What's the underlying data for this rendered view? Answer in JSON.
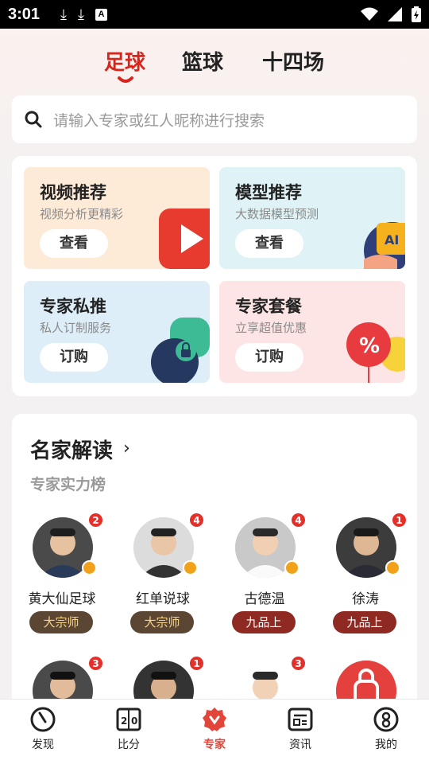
{
  "status_bar": {
    "time": "3:01",
    "icons": [
      "download-icon",
      "download-icon",
      "a-icon",
      "wifi-icon",
      "signal-icon",
      "battery-charging-icon"
    ]
  },
  "tabs": [
    {
      "label": "足球",
      "active": true
    },
    {
      "label": "篮球",
      "active": false
    },
    {
      "label": "十四场",
      "active": false
    }
  ],
  "search": {
    "placeholder": "请输入专家或红人昵称进行搜索"
  },
  "features": [
    {
      "title": "视频推荐",
      "subtitle": "视频分析更精彩",
      "button": "查看",
      "bg": "#fdebd8"
    },
    {
      "title": "模型推荐",
      "subtitle": "大数据模型预测",
      "button": "查看",
      "bg": "#dff3f6"
    },
    {
      "title": "专家私推",
      "subtitle": "私人订制服务",
      "button": "订购",
      "bg": "#deeef9"
    },
    {
      "title": "专家套餐",
      "subtitle": "立享超值优惠",
      "button": "订购",
      "bg": "#fde5e5"
    }
  ],
  "experts_section": {
    "title": "名家解读",
    "subtitle": "专家实力榜",
    "experts": [
      {
        "name": "黄大仙足球",
        "rank": "大宗师",
        "count": "2"
      },
      {
        "name": "红单说球",
        "rank": "大宗师",
        "count": "4"
      },
      {
        "name": "古德温",
        "rank": "九品上",
        "count": "4"
      },
      {
        "name": "徐涛",
        "rank": "九品上",
        "count": "1"
      }
    ],
    "row2_counts": [
      "3",
      "1",
      "3"
    ]
  },
  "bottom_nav": [
    {
      "label": "发现",
      "icon": "discover-icon",
      "active": false
    },
    {
      "label": "比分",
      "icon": "score-icon",
      "active": false
    },
    {
      "label": "专家",
      "icon": "expert-icon",
      "active": true
    },
    {
      "label": "资讯",
      "icon": "news-icon",
      "active": false
    },
    {
      "label": "我的",
      "icon": "profile-icon",
      "active": false
    }
  ],
  "colors": {
    "accent": "#d8251b",
    "nav_active": "#e2463a",
    "grandmaster": "#5b4634",
    "rank_up": "#8e2a22"
  }
}
